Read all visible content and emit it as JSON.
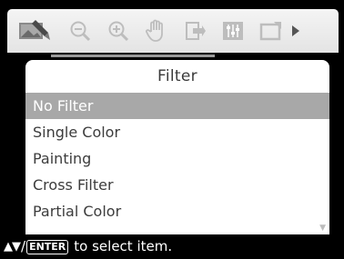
{
  "toolbar": {
    "icons": [
      "edit-image-icon",
      "zoom-out-icon",
      "zoom-in-icon",
      "hand-pan-icon",
      "export-icon",
      "adjust-icon",
      "frame-icon",
      "next-arrow-icon"
    ]
  },
  "menu": {
    "title": "Filter",
    "items": [
      {
        "label": "No Filter",
        "selected": true
      },
      {
        "label": "Single Color",
        "selected": false
      },
      {
        "label": "Painting",
        "selected": false
      },
      {
        "label": "Cross Filter",
        "selected": false
      },
      {
        "label": "Partial Color",
        "selected": false
      }
    ]
  },
  "hint": {
    "keys_updown": "▲▼",
    "slash": "/",
    "enter_key": "ENTER",
    "text": "to select item."
  },
  "colors": {
    "selected_bg": "#a8a8a8",
    "panel_bg": "#ffffff",
    "screen_bg": "#000000"
  }
}
